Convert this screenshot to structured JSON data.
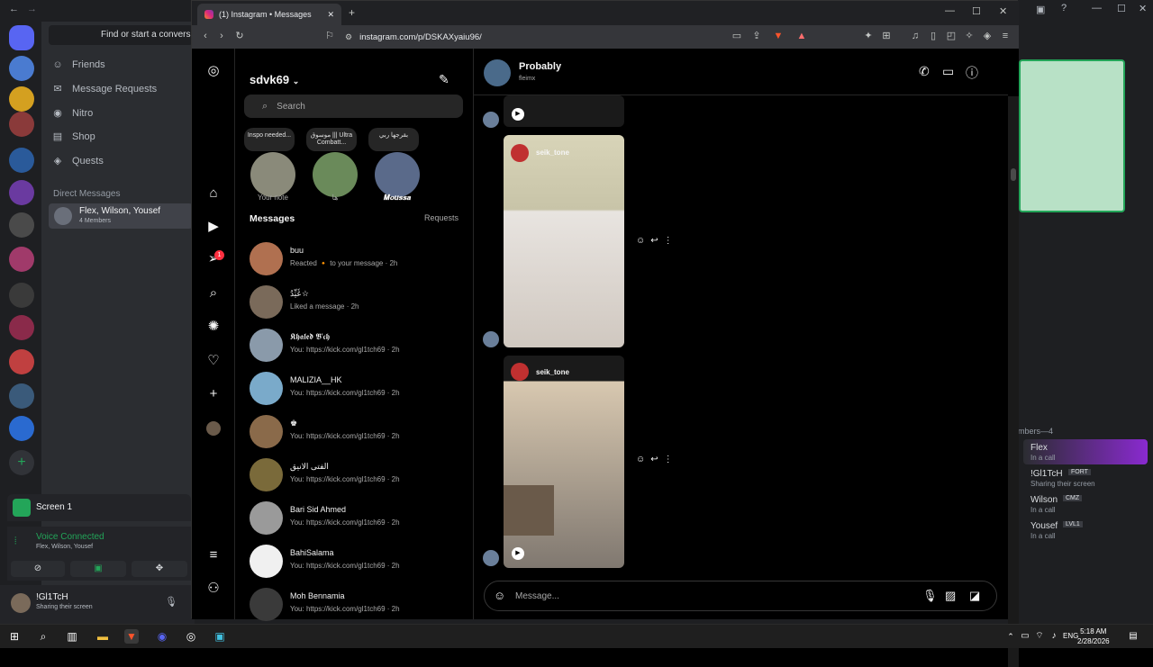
{
  "discord": {
    "search_placeholder": "Find or start a conversat",
    "nav": [
      "Friends",
      "Message Requests",
      "Nitro",
      "Shop",
      "Quests"
    ],
    "dm_heading": "Direct Messages",
    "group": {
      "name": "Flex, Wilson, Yousef",
      "members": "4 Members"
    },
    "screen_label": "Screen 1",
    "voice": {
      "status": "Voice Connected",
      "participants": "Flex, Wilson, Yousef"
    },
    "user": {
      "name": "!Gl1TcH",
      "status": "Sharing their screen"
    },
    "members_header": "mbers—4",
    "members": [
      {
        "name": "Flex",
        "tag": "",
        "status": "In a call"
      },
      {
        "name": "!Gl1TcH",
        "tag": "FORT",
        "status": "Sharing their screen"
      },
      {
        "name": "Wilson",
        "tag": "CMZ",
        "status": "In a call"
      },
      {
        "name": "Yousef",
        "tag": "LVL1",
        "status": "In a call"
      }
    ]
  },
  "browser": {
    "tab_title": "(1) Instagram • Messages",
    "url": "instagram.com/p/DSKAXyaiu96/"
  },
  "instagram": {
    "username": "sdvk69",
    "search_placeholder": "Search",
    "notes": [
      {
        "text": "Inspo needed...",
        "caption": "Your note"
      },
      {
        "text": "موسوق ||| Ultra Combatt...",
        "caption": "ها"
      },
      {
        "text": "بقرجها ربي",
        "caption": "𝑴𝒐𝒖𝒔𝒔𝒂"
      }
    ],
    "messages_heading": "Messages",
    "requests_label": "Requests",
    "conversations": [
      {
        "name": "buu",
        "preview": "Reacted 🔸 to your message · 2h"
      },
      {
        "name": "ڠَيِّدُ☆",
        "preview": "Liked a message · 2h"
      },
      {
        "name": "𝕶𝖍𝖆𝖑𝖊𝖉 𝕭'𝖈𝖍",
        "preview": "You: https://kick.com/gl1tch69 · 2h"
      },
      {
        "name": "MALIZIA__HK",
        "preview": "You: https://kick.com/gl1tch69 · 2h"
      },
      {
        "name": "♚",
        "preview": "You: https://kick.com/gl1tch69 · 2h"
      },
      {
        "name": "الفتى الانيق",
        "preview": "You: https://kick.com/gl1tch69 · 2h"
      },
      {
        "name": "Bari Sid Ahmed",
        "preview": "You: https://kick.com/gl1tch69 · 2h"
      },
      {
        "name": "BahiSalama",
        "preview": "You: https://kick.com/gl1tch69 · 2h"
      },
      {
        "name": "Moh Bennamia",
        "preview": "You: https://kick.com/gl1tch69 · 2h"
      }
    ],
    "chat": {
      "name": "Probably",
      "subtitle": "fleimx",
      "reel_user": "seik_tone",
      "composer_placeholder": "Message..."
    }
  },
  "taskbar": {
    "language": "ENG",
    "time": "5:18 AM",
    "date": "2/28/2026"
  }
}
